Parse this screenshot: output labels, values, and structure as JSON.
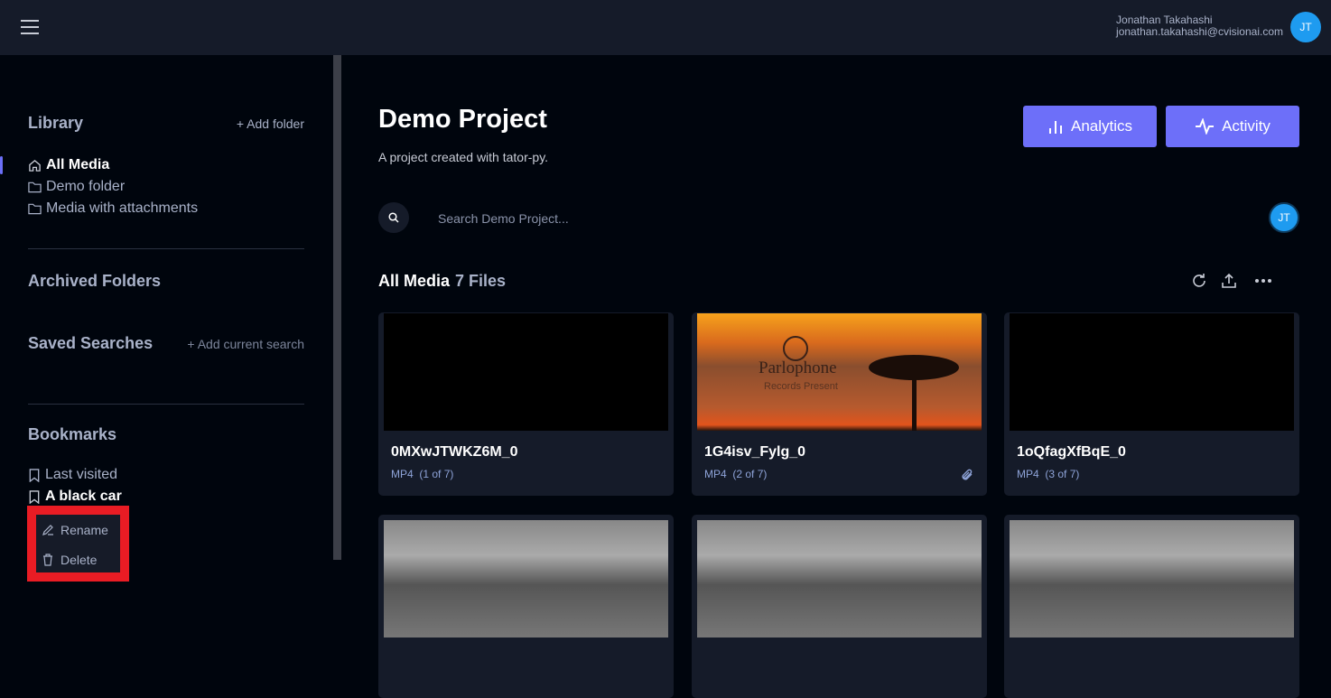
{
  "header": {
    "user_name": "Jonathan Takahashi",
    "user_email": "jonathan.takahashi@cvisionai.com",
    "avatar_initials": "JT"
  },
  "sidebar": {
    "library_title": "Library",
    "add_folder": "+ Add folder",
    "library_items": [
      {
        "label": "All Media",
        "icon": "home-icon"
      },
      {
        "label": "Demo folder",
        "icon": "folder-icon"
      },
      {
        "label": "Media with attachments",
        "icon": "folder-icon"
      }
    ],
    "archived_title": "Archived Folders",
    "saved_title": "Saved Searches",
    "add_search": "+ Add current search",
    "bookmarks_title": "Bookmarks",
    "bookmarks": [
      {
        "label": "Last visited"
      },
      {
        "label": "A black car"
      }
    ],
    "context_menu": {
      "rename": "Rename",
      "delete": "Delete"
    }
  },
  "main": {
    "title": "Demo Project",
    "subtitle": "A project created with tator-py.",
    "analytics": "Analytics",
    "activity": "Activity",
    "search_placeholder": "Search Demo Project...",
    "avatar_initials": "JT",
    "section_title": "All Media",
    "file_count": "7 Files",
    "cards": [
      {
        "name": "0MXwJTWKZ6M_0",
        "type": "MP4",
        "index": "(1 of 7)"
      },
      {
        "name": "1G4isv_Fylg_0",
        "type": "MP4",
        "index": "(2 of 7)",
        "thumb_text": "Parlophone",
        "thumb_sub": "Records Present"
      },
      {
        "name": "1oQfagXfBqE_0",
        "type": "MP4",
        "index": "(3 of 7)"
      }
    ]
  },
  "colors": {
    "accent": "#6d6ff9",
    "avatar": "#1e9bf0",
    "highlight": "#e91c24"
  }
}
